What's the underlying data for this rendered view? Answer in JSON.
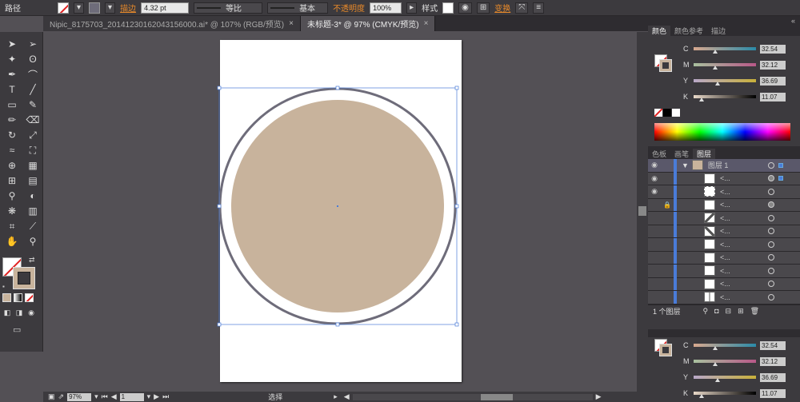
{
  "control_bar": {
    "path_label": "路径",
    "stroke_label": "描边",
    "stroke_weight": "4.32 pt",
    "profile_label": "等比",
    "brush_label": "基本",
    "opacity_label": "不透明度",
    "opacity_value": "100%",
    "style_label": "样式",
    "transform_label": "变换"
  },
  "tabs": [
    {
      "label": "Nipic_8175703_20141230162043156000.ai* @ 107% (RGB/预览)"
    },
    {
      "label": "未标题-3* @ 97% (CMYK/预览)"
    }
  ],
  "status": {
    "zoom": "97%",
    "page": "1",
    "tool": "选择"
  },
  "colors": {
    "circle_fill": "#c8b39c",
    "circle_stroke": "#6e6c7a",
    "selection": "#4a7cd8"
  },
  "color_panel": {
    "tabs": [
      "颜色",
      "颜色参考",
      "描边"
    ],
    "channels": [
      {
        "label": "C",
        "value": "32.54"
      },
      {
        "label": "M",
        "value": "32.12"
      },
      {
        "label": "Y",
        "value": "36.69"
      },
      {
        "label": "K",
        "value": "11.07"
      }
    ]
  },
  "layers_panel": {
    "tabs": [
      "色板",
      "画笔",
      "图层"
    ],
    "layer_name": "图层 1",
    "sublayer_label": "<...",
    "count_label": "1 个图层"
  },
  "color_panel_2": {
    "channels": [
      {
        "label": "C",
        "value": "32.54"
      },
      {
        "label": "M",
        "value": "32.12"
      },
      {
        "label": "Y",
        "value": "36.69"
      },
      {
        "label": "K",
        "value": "11.07"
      }
    ]
  }
}
